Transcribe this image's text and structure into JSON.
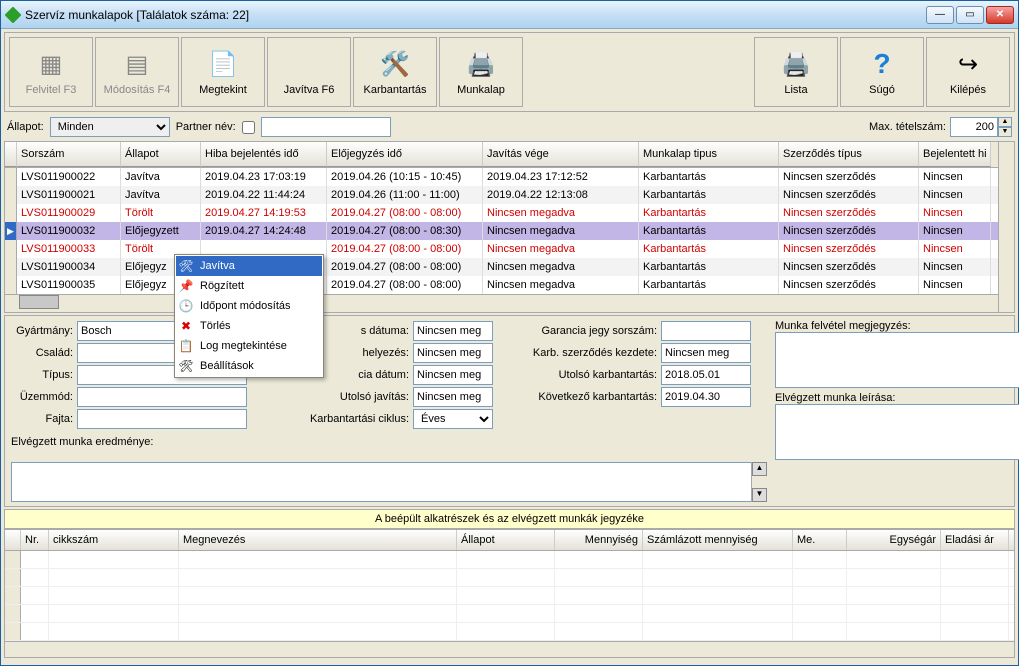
{
  "window": {
    "title": "Szervíz munkalapok [Találatok száma: 22]"
  },
  "toolbar": {
    "felvitel": "Felvitel F3",
    "modositas": "Módosítás F4",
    "megtekint": "Megtekint",
    "javitva": "Javítva F6",
    "karbantartas": "Karbantartás",
    "munkalap": "Munkalap",
    "lista": "Lista",
    "sugo": "Súgó",
    "kilepes": "Kilépés"
  },
  "filter": {
    "allapot_label": "Állapot:",
    "allapot_value": "Minden",
    "partner_label": "Partner név:",
    "partner_value": "",
    "max_label": "Max. tételszám:",
    "max_value": "200"
  },
  "grid": {
    "headers": [
      "Sorszám",
      "Állapot",
      "Hiba bejelentés idő",
      "Előjegyzés idő",
      "Javítás vége",
      "Munkalap tipus",
      "Szerződés típus",
      "Bejelentett hi"
    ],
    "rows": [
      {
        "sorsz": "LVS011900022",
        "allapot": "Javítva",
        "hiba": "2019.04.23 17:03:19",
        "elo": "2019.04.26 (10:15 - 10:45)",
        "vege": "2019.04.23 17:12:52",
        "tipus": "Karbantartás",
        "szerz": "Nincsen szerződés",
        "bej": "Nincsen",
        "class": ""
      },
      {
        "sorsz": "LVS011900021",
        "allapot": "Javítva",
        "hiba": "2019.04.22 11:44:24",
        "elo": "2019.04.26 (11:00 - 11:00)",
        "vege": "2019.04.22 12:13:08",
        "tipus": "Karbantartás",
        "szerz": "Nincsen szerződés",
        "bej": "Nincsen",
        "class": "alt"
      },
      {
        "sorsz": "LVS011900029",
        "allapot": "Törölt",
        "hiba": "2019.04.27 14:19:53",
        "elo": "2019.04.27 (08:00 - 08:00)",
        "vege": "Nincsen megadva",
        "tipus": "Karbantartás",
        "szerz": "Nincsen szerződés",
        "bej": "Nincsen",
        "class": "deleted"
      },
      {
        "sorsz": "LVS011900032",
        "allapot": "Előjegyzett",
        "hiba": "2019.04.27 14:24:48",
        "elo": "2019.04.27 (08:00 - 08:30)",
        "vege": "Nincsen megadva",
        "tipus": "Karbantartás",
        "szerz": "Nincsen szerződés",
        "bej": "Nincsen",
        "class": "sel"
      },
      {
        "sorsz": "LVS011900033",
        "allapot": "Törölt",
        "hiba": "",
        "elo": "2019.04.27 (08:00 - 08:00)",
        "vege": "Nincsen megadva",
        "tipus": "Karbantartás",
        "szerz": "Nincsen szerződés",
        "bej": "Nincsen",
        "class": "deleted"
      },
      {
        "sorsz": "LVS011900034",
        "allapot": "Előjegyz",
        "hiba": "",
        "elo": "2019.04.27 (08:00 - 08:00)",
        "vege": "Nincsen megadva",
        "tipus": "Karbantartás",
        "szerz": "Nincsen szerződés",
        "bej": "Nincsen",
        "class": "alt"
      },
      {
        "sorsz": "LVS011900035",
        "allapot": "Előjegyz",
        "hiba": "",
        "elo": "2019.04.27 (08:00 - 08:00)",
        "vege": "Nincsen megadva",
        "tipus": "Karbantartás",
        "szerz": "Nincsen szerződés",
        "bej": "Nincsen",
        "class": ""
      }
    ]
  },
  "ctx": {
    "javitva": "Javítva",
    "rogzitett": "Rögzített",
    "idopont": "Időpont módosítás",
    "torles": "Törlés",
    "log": "Log megtekintése",
    "beall": "Beállítások"
  },
  "details": {
    "gyartmany_l": "Gyártmány:",
    "gyartmany_v": "Bosch",
    "csalad_l": "Család:",
    "csalad_v": "",
    "tipus_l": "Típus:",
    "tipus_v": "",
    "uzemmod_l": "Üzemmód:",
    "uzemmod_v": "",
    "fajta_l": "Fajta:",
    "fajta_v": "",
    "eredmeny_l": "Elvégzett munka eredménye:",
    "eredmeny_v": "",
    "sdatuma_l": "s dátuma:",
    "sdatuma_v": "Nincsen meg",
    "helyezés_l": "helyezés:",
    "helyezés_v": "Nincsen meg",
    "ciadat_l": "cia dátum:",
    "ciadat_v": "Nincsen meg",
    "utjav_l": "Utolsó javítás:",
    "utjav_v": "Nincsen meg",
    "kciklus_l": "Karbantartási ciklus:",
    "kciklus_v": "Éves",
    "garjegy_l": "Garancia jegy sorszám:",
    "garjegy_v": "",
    "karbkezd_l": "Karb. szerződés kezdete:",
    "karbkezd_v": "Nincsen meg",
    "utkarb_l": "Utolsó karbantartás:",
    "utkarb_v": "2018.05.01",
    "kovkarb_l": "Következő karbantartás:",
    "kovkarb_v": "2019.04.30",
    "munkafelv_l": "Munka felvétel megjegyzés:",
    "elvmunka_l": "Elvégzett munka leírása:"
  },
  "parts": {
    "title": "A beépült alkatrészek és az elvégzett munkák jegyzéke",
    "headers": [
      "Nr.",
      "cikkszám",
      "Megnevezés",
      "Állapot",
      "Mennyiség",
      "Számlázott mennyiség",
      "Me.",
      "Egységár",
      "Eladási ár"
    ]
  }
}
